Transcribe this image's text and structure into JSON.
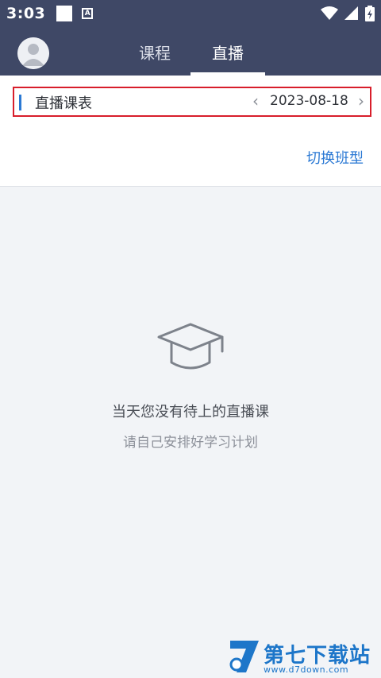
{
  "status_bar": {
    "time": "3:03",
    "icons": [
      "notification-square-icon",
      "keyboard-a-icon",
      "wifi-icon",
      "signal-icon",
      "battery-charging-icon"
    ]
  },
  "nav": {
    "tabs": [
      {
        "label": "课程",
        "active": false
      },
      {
        "label": "直播",
        "active": true
      }
    ]
  },
  "schedule": {
    "title": "直播课表",
    "date": "2023-08-18",
    "prev_icon": "‹",
    "next_icon": "›"
  },
  "switch_class_label": "切换班型",
  "empty_state": {
    "icon": "graduation-cap-icon",
    "title": "当天您没有待上的直播课",
    "subtitle": "请自己安排好学习计划"
  },
  "watermark": {
    "brand": "第七下载站",
    "url": "www.d7down.com"
  },
  "colors": {
    "header_bg": "#3f4866",
    "accent_blue": "#2b79d4",
    "highlight_red": "#d81e2b",
    "page_bg": "#f2f4f7"
  }
}
